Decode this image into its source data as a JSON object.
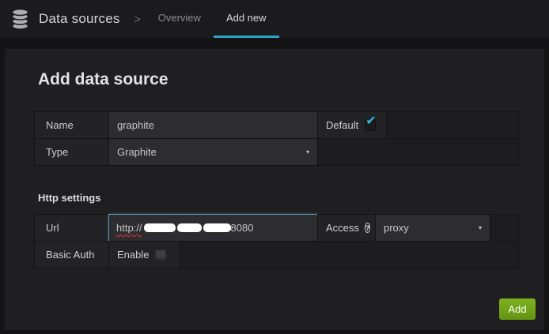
{
  "header": {
    "title": "Data sources",
    "separator": ">",
    "tabs": [
      {
        "label": "Overview",
        "active": false
      },
      {
        "label": "Add new",
        "active": true
      }
    ]
  },
  "page": {
    "title": "Add data source",
    "http_section_title": "Http settings"
  },
  "form": {
    "name": {
      "label": "Name",
      "value": "graphite"
    },
    "default_checkbox": {
      "label": "Default",
      "checked": true
    },
    "type": {
      "label": "Type",
      "value": "Graphite"
    },
    "url": {
      "label": "Url",
      "prefix": "http://",
      "suffix": "8080",
      "redacted": true
    },
    "access": {
      "label": "Access",
      "value": "proxy"
    },
    "basic_auth": {
      "label": "Basic Auth",
      "enable_label": "Enable",
      "checked": false
    }
  },
  "actions": {
    "add_label": "Add"
  },
  "icons": {
    "help": "?",
    "dropdown_arrow": "▾",
    "check": "✔",
    "database": "database-icon"
  },
  "colors": {
    "accent_tab": "#2da4c9",
    "check": "#34b5e5",
    "add_button": "#6ea31c",
    "focus_border": "#5b93ad"
  }
}
